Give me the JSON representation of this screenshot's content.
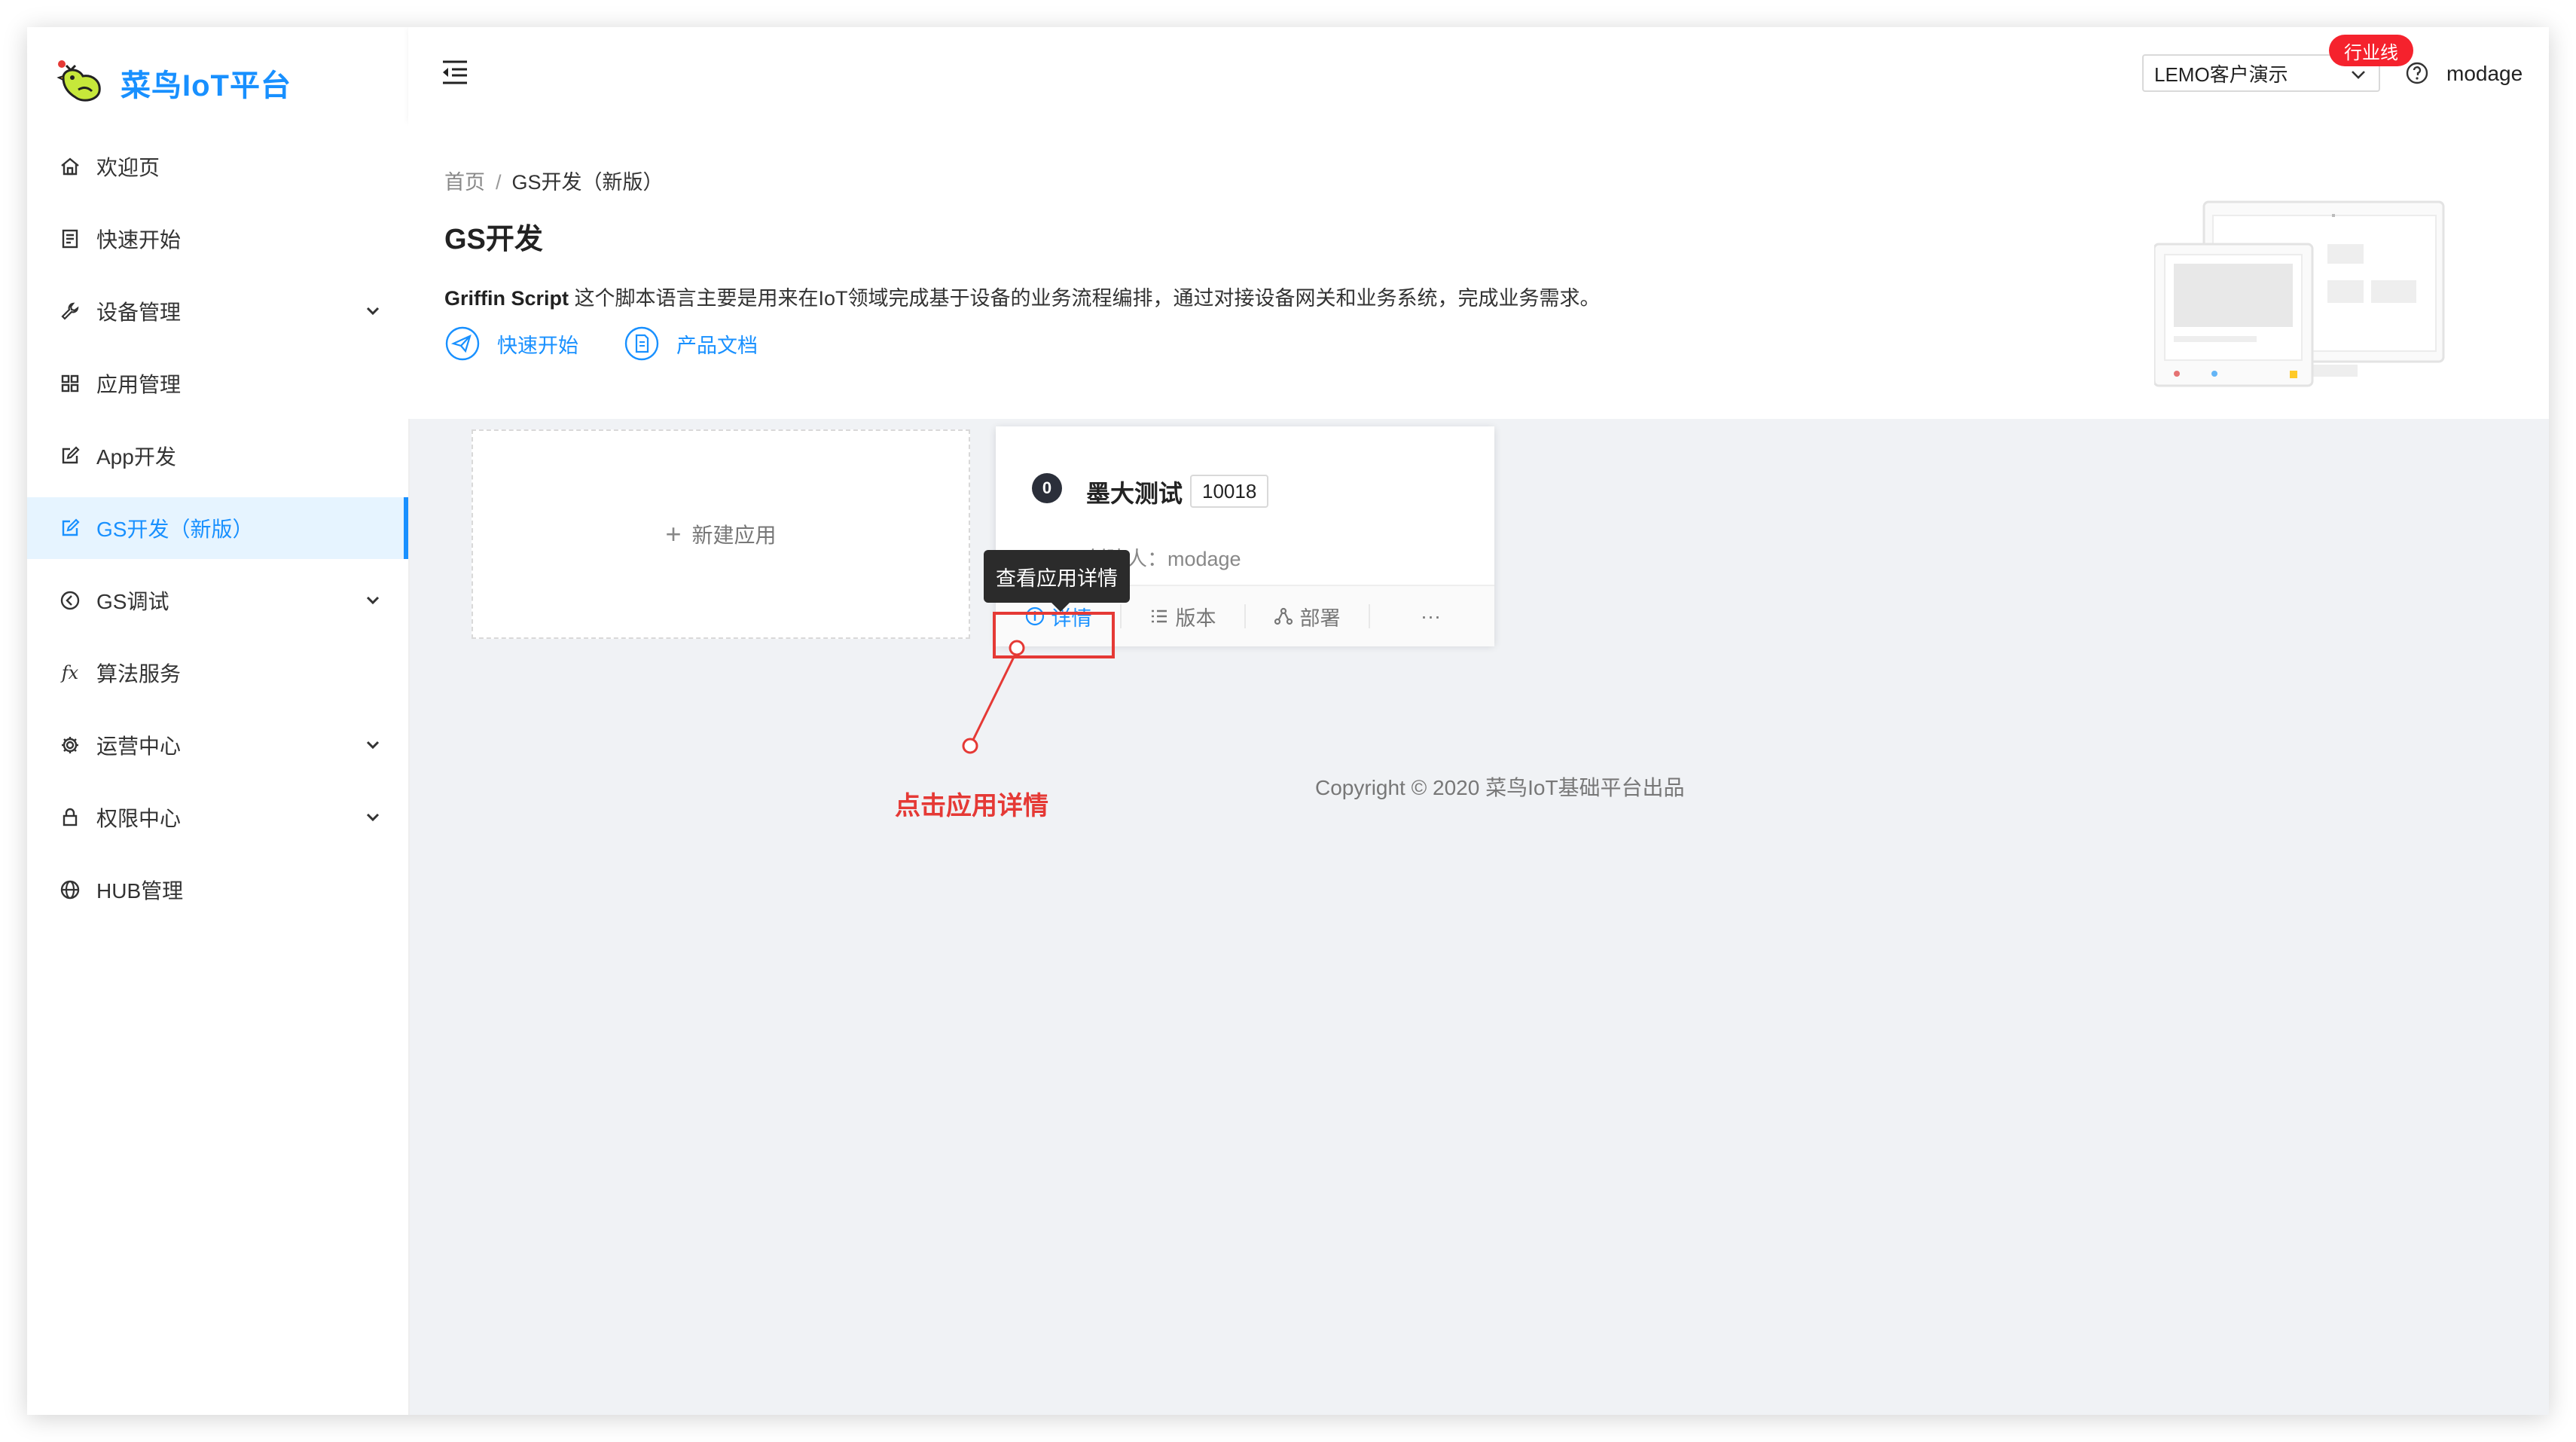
{
  "brand": {
    "name": "菜鸟IoT平台"
  },
  "sidebar": {
    "items": [
      {
        "label": "欢迎页",
        "icon": "home-icon"
      },
      {
        "label": "快速开始",
        "icon": "book-icon"
      },
      {
        "label": "设备管理",
        "icon": "wrench-icon",
        "expandable": true
      },
      {
        "label": "应用管理",
        "icon": "grid-icon"
      },
      {
        "label": "App开发",
        "icon": "edit-icon"
      },
      {
        "label": "GS开发（新版）",
        "icon": "edit-icon",
        "active": true
      },
      {
        "label": "GS调试",
        "icon": "clock-back-icon",
        "expandable": true
      },
      {
        "label": "算法服务",
        "icon": "fx-icon",
        "glyph": "fx"
      },
      {
        "label": "运营中心",
        "icon": "gear-icon",
        "expandable": true
      },
      {
        "label": "权限中心",
        "icon": "lock-icon",
        "expandable": true
      },
      {
        "label": "HUB管理",
        "icon": "globe-icon"
      }
    ]
  },
  "header": {
    "tenant": "LEMO客户演示",
    "badge": "行业线",
    "username": "modage"
  },
  "page": {
    "breadcrumb": {
      "home": "首页",
      "separator": "/",
      "current": "GS开发（新版）"
    },
    "title": "GS开发",
    "description_bold": "Griffin Script",
    "description": " 这个脚本语言主要是用来在IoT领域完成基于设备的业务流程编排，通过对接设备网关和业务系统，完成业务需求。",
    "links": {
      "quick_start": "快速开始",
      "docs": "产品文档"
    }
  },
  "new_app": {
    "plus": "+",
    "label": "新建应用"
  },
  "app_card": {
    "status": "0",
    "name": "墨大测试",
    "id": "10018",
    "creator_label": "创建人：",
    "creator": "modage",
    "actions": {
      "detail": "详情",
      "version": "版本",
      "deploy": "部署",
      "more": "···"
    }
  },
  "tooltip": "查看应用详情",
  "annotation": "点击应用详情",
  "footer": {
    "copyright": "Copyright © 2020 菜鸟IoT基础平台出品"
  },
  "colors": {
    "primary": "#1890ff",
    "annotation": "#e53935",
    "badge": "#f5222d",
    "content_bg": "#f0f2f5"
  }
}
